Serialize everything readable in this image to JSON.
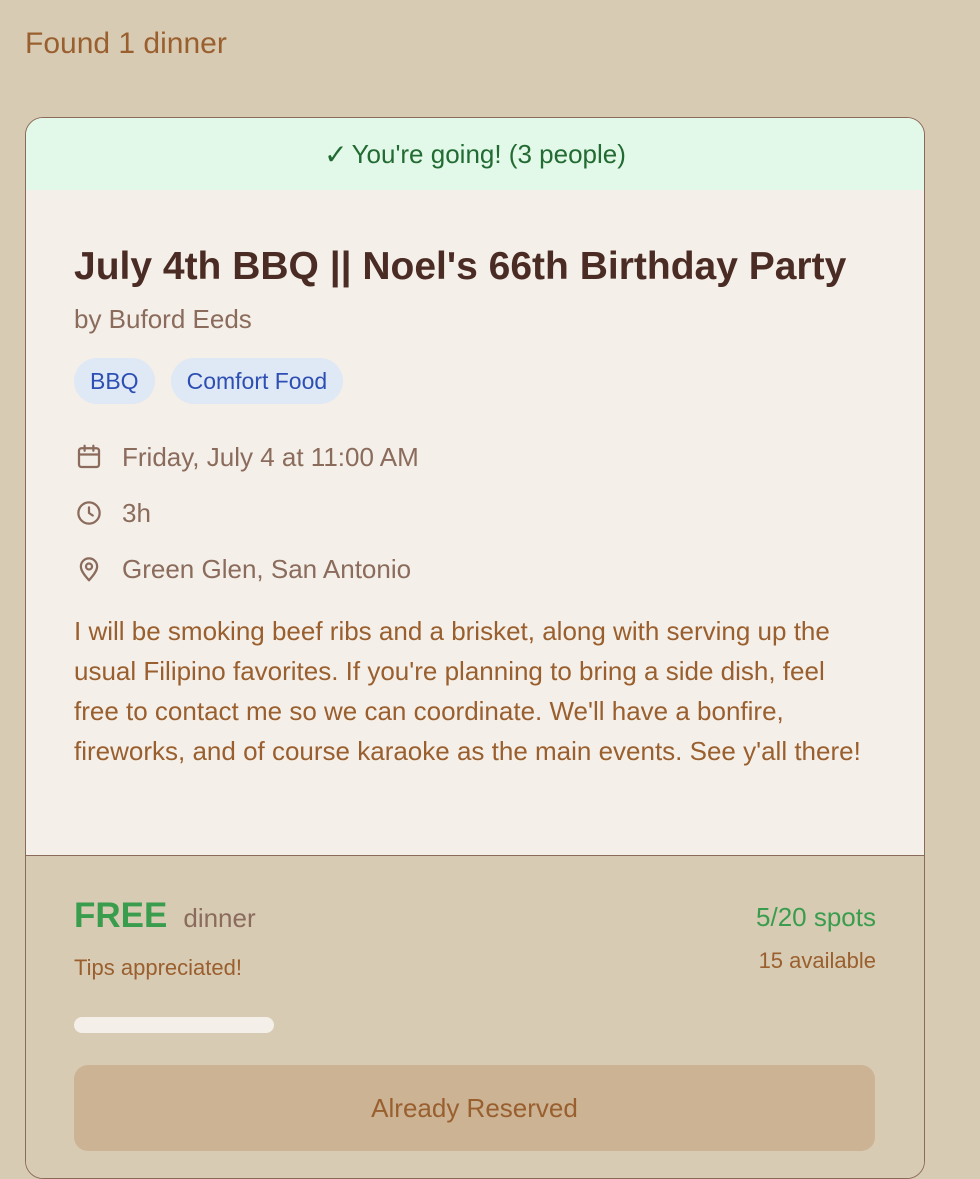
{
  "results": {
    "count_text": "Found 1 dinner"
  },
  "dinner": {
    "status_banner": "You're going! (3 people)",
    "title": "July 4th BBQ || Noel's 66th Birthday Party",
    "host": "by Buford Eeds",
    "tags": [
      "BBQ",
      "Comfort Food"
    ],
    "datetime": "Friday, July 4 at 11:00 AM",
    "duration": "3h",
    "location": "Green Glen, San Antonio",
    "description": "I will be smoking beef ribs and a brisket, along with serving up the usual Filipino favorites. If you're planning to bring a side dish, feel free to contact me so we can coordinate. We'll have a bonfire, fireworks, and of course karaoke as the main events. See y'all there!",
    "price": "FREE",
    "price_unit": "dinner",
    "price_note": "Tips appreciated!",
    "spots": "5/20 spots",
    "available": "15 available",
    "capacity_fill_fraction": 0.0,
    "action_label": "Already Reserved"
  },
  "icons": {
    "check": "check-icon",
    "date": "calendar-icon",
    "duration": "clock-icon",
    "location": "map-pin-icon"
  },
  "colors": {
    "background": "#d8cbb3",
    "card": "#f4efe8",
    "going_banner": "#e2f8e8",
    "accent_green": "#3a9d4e",
    "tag_background": "#dfe8f5",
    "tag_text": "#2d4fb3",
    "button": "#cbb394"
  }
}
